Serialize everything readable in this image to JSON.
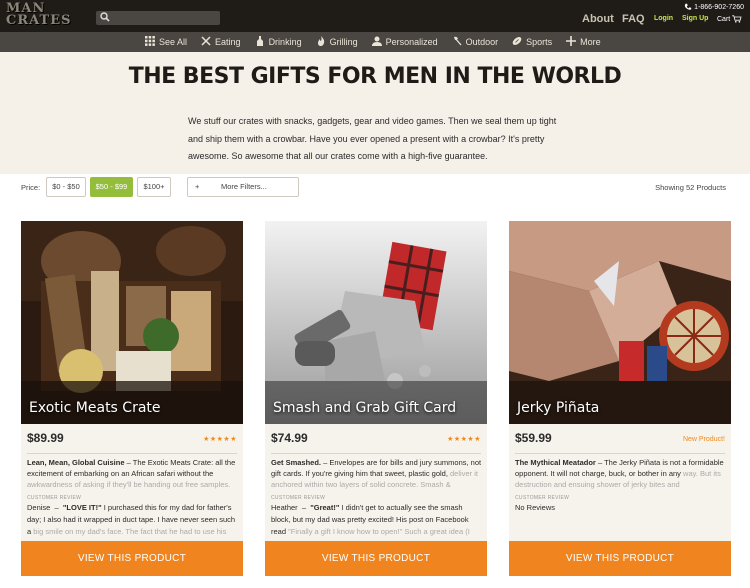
{
  "header": {
    "logo_line1": "MAN",
    "logo_line2": "CRATES",
    "phone": "1-866-902-7260",
    "about": "About",
    "faq": "FAQ",
    "login": "Login",
    "signup": "Sign Up",
    "cart": "Cart"
  },
  "nav": {
    "items": [
      {
        "label": "See All",
        "icon": "grid-icon"
      },
      {
        "label": "Eating",
        "icon": "utensils-icon"
      },
      {
        "label": "Drinking",
        "icon": "bottle-icon"
      },
      {
        "label": "Grilling",
        "icon": "flame-icon"
      },
      {
        "label": "Personalized",
        "icon": "person-icon"
      },
      {
        "label": "Outdoor",
        "icon": "axe-icon"
      },
      {
        "label": "Sports",
        "icon": "football-icon"
      },
      {
        "label": "More",
        "icon": "plus-icon"
      }
    ]
  },
  "hero": {
    "title": "THE BEST GIFTS FOR MEN IN THE WORLD",
    "text": "We stuff our crates with snacks, gadgets, gear and video games. Then we seal them up tight and ship them with a crowbar. Have you ever opened a present with a crowbar? It's pretty awesome. So awesome that all our crates come with a high-five guarantee."
  },
  "filters": {
    "price_label": "Price:",
    "options": [
      "$0 - $50",
      "$50 - $99",
      "$100+"
    ],
    "active": "$50 - $99",
    "more_plus": "+",
    "more_label": "More Filters...",
    "showing": "Showing 52 Products"
  },
  "products": [
    {
      "name": "Exotic Meats Crate",
      "price": "$89.99",
      "rating": "★★★★★",
      "desc_title": "Lean, Mean, Global Cuisine",
      "desc_text": " – The Exotic Meats Crate: all the excitement of embarking on an African safari without the ",
      "desc_fade": "awkwardness of asking if they'll be handing out free samples.",
      "review_label": "CUSTOMER REVIEW",
      "review_author": "Denise",
      "review_quote": "\"LOVE IT!\"",
      "review_text": " I purchased this for my dad for father's day; I also had it wrapped in duct tape. I have never seen such a ",
      "review_fade": "big smile on my dad's face. The fact that he had to use his",
      "button": "VIEW THIS PRODUCT"
    },
    {
      "name": "Smash and Grab Gift Card",
      "price": "$74.99",
      "rating": "★★★★★",
      "desc_title": "Get Smashed.",
      "desc_text": " – Envelopes are for bills and jury summons, not gift cards. If you're giving him that sweet, plastic gold, ",
      "desc_fade": "deliver it anchored within two layers of solid concrete. Smash &",
      "review_label": "CUSTOMER REVIEW",
      "review_author": "Heather",
      "review_quote": "\"Great!\"",
      "review_text": " I didn't get to actually see the smash block, but my dad was pretty excited! His post on Facebook read ",
      "review_fade": "\"Finally a gift I know how to open!\" Such a great idea (I suggest",
      "button": "VIEW THIS PRODUCT"
    },
    {
      "name": "Jerky Piñata",
      "price": "$59.99",
      "badge": "New Product!",
      "desc_title": "The Mythical Meatador",
      "desc_text": " – The Jerky Piñata is not a formidable opponent. It will not charge, buck, or bother in any ",
      "desc_fade": "way. But its destruction and ensuing shower of jerky bites and",
      "review_label": "CUSTOMER REVIEW",
      "review_text": "No Reviews",
      "button": "VIEW THIS PRODUCT"
    }
  ],
  "colors": {
    "accent_orange": "#f0851f",
    "accent_green": "#94bd3c",
    "header_bg": "#1f1c18",
    "nav_bg": "#4a4642"
  }
}
